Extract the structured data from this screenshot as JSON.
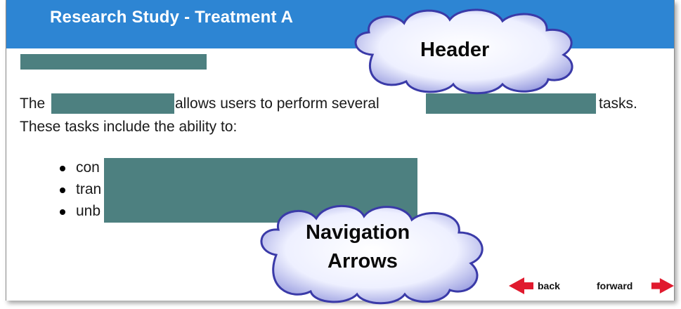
{
  "header": {
    "title": "Research Study - Treatment A"
  },
  "content": {
    "para_start": "The",
    "para_middle": "allows users to perform several",
    "para_end": "tasks.",
    "para_line2": "These tasks include the ability to:",
    "bullets": [
      "con",
      "tran",
      "unb"
    ]
  },
  "navigation": {
    "back_label": "back",
    "forward_label": "forward"
  },
  "callouts": {
    "header": "Header",
    "navigation_line1": "Navigation",
    "navigation_line2": "Arrows"
  },
  "colors": {
    "header_bar": "#2d85d3",
    "redaction": "#4d8080",
    "arrow": "#e01a2e",
    "cloud_fill": "#f4f4ff",
    "cloud_edge": "#3a3aa8"
  }
}
